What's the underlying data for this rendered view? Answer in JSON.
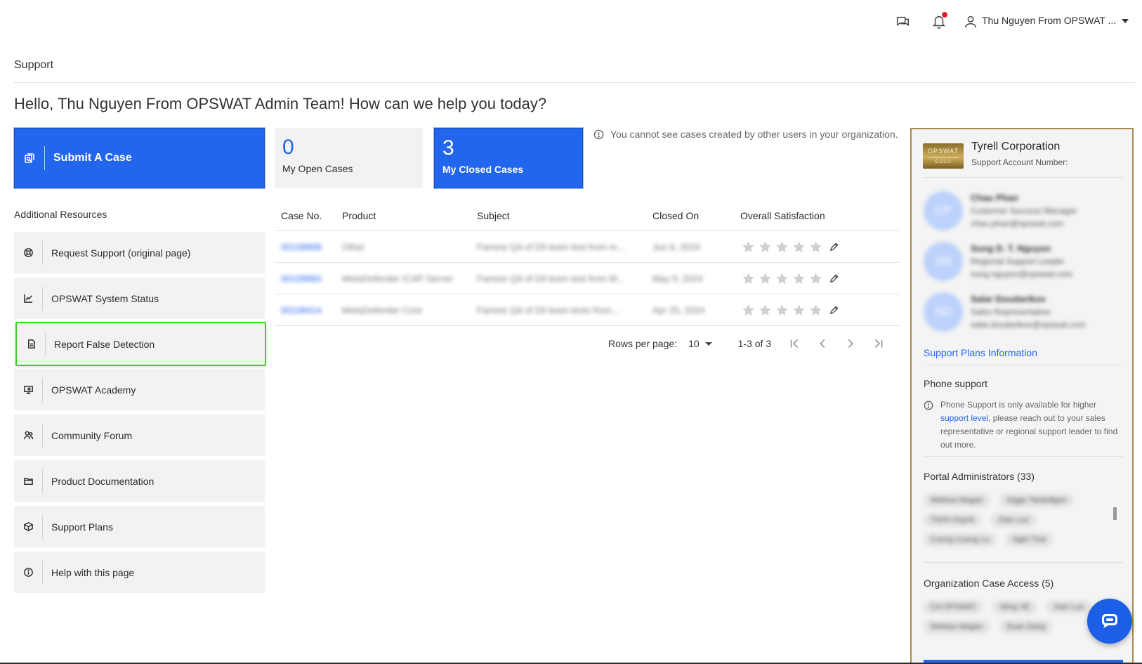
{
  "header": {
    "user_name": "Thu Nguyen From OPSWAT ...",
    "icons": [
      "chat-icon",
      "bell-icon",
      "user-icon"
    ],
    "notification_dot_color": "#e0202a"
  },
  "page": {
    "heading": "Support",
    "greeting": "Hello, Thu Nguyen From OPSWAT Admin Team! How can we help you today?"
  },
  "actions": {
    "submit_label": "Submit A Case",
    "open_count": "0",
    "open_label": "My Open Cases",
    "closed_count": "3",
    "closed_label": "My Closed Cases",
    "notice": "You cannot see cases created by other users in your organization."
  },
  "resources": {
    "title": "Additional Resources",
    "items": [
      {
        "label": "Request Support (original page)",
        "icon": "lifebuoy-icon"
      },
      {
        "label": "OPSWAT System Status",
        "icon": "chart-line-icon"
      },
      {
        "label": "Report False Detection",
        "icon": "document-icon"
      },
      {
        "label": "OPSWAT Academy",
        "icon": "presentation-icon"
      },
      {
        "label": "Community Forum",
        "icon": "users-icon"
      },
      {
        "label": "Product Documentation",
        "icon": "folder-icon"
      },
      {
        "label": "Support Plans",
        "icon": "box-icon"
      },
      {
        "label": "Help with this page",
        "icon": "info-icon"
      }
    ]
  },
  "table": {
    "headers": [
      "Case No.",
      "Product",
      "Subject",
      "Closed On",
      "Overall Satisfaction"
    ],
    "rows": [
      {
        "case_no": "00109898",
        "product": "Other",
        "subject": "Famine QA of Dil team test from m...",
        "closed_on": "Jun 6, 2024"
      },
      {
        "case_no": "00109860",
        "product": "MetaDefender ICAP Server",
        "subject": "Famine QA of Dil team test from M...",
        "closed_on": "May 9, 2024"
      },
      {
        "case_no": "00108414",
        "product": "MetaDefender Core",
        "subject": "Famine QA of Dil team tests from...",
        "closed_on": "Apr 25, 2024"
      }
    ],
    "rating_max": 5,
    "ratings": [
      0,
      0,
      0
    ]
  },
  "pagination": {
    "rows_per_page_label": "Rows per page:",
    "rows_per_page_value": "10",
    "range": "1-3 of 3"
  },
  "panel": {
    "logo_text": "OPSWAT",
    "logo_tier": "GOLD",
    "company": "Tyrell Corporation",
    "account_label": "Support Account Number:",
    "contacts": [
      {
        "initials": "CP",
        "name": "Chau Phan",
        "role": "Customer Success Manager",
        "email": "chau.phan@opswat.com"
      },
      {
        "initials": "SN",
        "name": "Sung D. T. Nguyen",
        "role": "Regional Support Leader",
        "email": "sung.nguyen@opswat.com"
      },
      {
        "initials": "SD",
        "name": "Salar Doudarikov",
        "role": "Sales Representative",
        "email": "salar.doudarikov@opswat.com"
      }
    ],
    "plans_link": "Support Plans Information",
    "phone_title": "Phone support",
    "phone_text_1": "Phone Support is only available for higher",
    "phone_link": "support level",
    "phone_text_2": ", please reach out to your sales representative or regional support leader to find out more.",
    "admins_title": "Portal Administrators (33)",
    "admins": [
      "Melissa Magan",
      "Giggs Tantedigan",
      "Thinh Huynh",
      "Xian Luu",
      "Cuong Cuong Lu",
      "Nghi Thai"
    ],
    "access_title": "Organization Case Access (5)",
    "access": [
      "CA OPSWAT",
      "Sting VE",
      "Xian Luu",
      "Melissa Magan",
      "Suan Dang"
    ]
  },
  "colors": {
    "accent": "#2266ee",
    "highlight_outline": "#3ccf2a",
    "panel_border": "#a88a4c"
  }
}
